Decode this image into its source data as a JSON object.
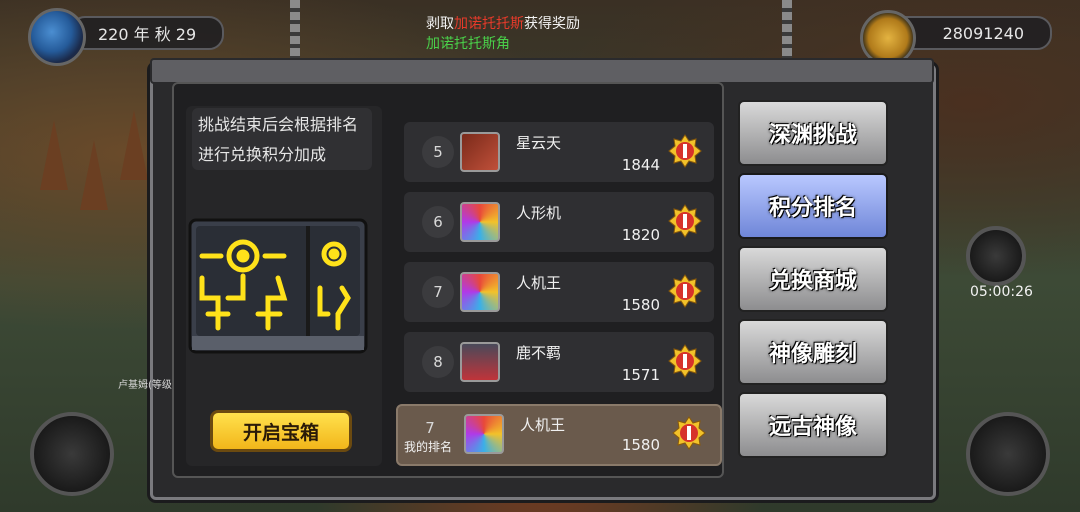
{
  "hud": {
    "date_text": "220 年 秋 29",
    "gold_amount": "28091240"
  },
  "notice": {
    "prefix": "剥取",
    "item_red": "加诺托托斯",
    "middle": "获得奖励",
    "reward_green": "加诺托托斯角"
  },
  "left_panel": {
    "tip_text": "挑战结束后会根据排名进行兑换积分加成",
    "open_chest_label": "开启宝箱"
  },
  "ranking": {
    "rows": [
      {
        "rank": "5",
        "name": "星云天",
        "score": "1844"
      },
      {
        "rank": "6",
        "name": "人形机",
        "score": "1820"
      },
      {
        "rank": "7",
        "name": "人机王",
        "score": "1580"
      },
      {
        "rank": "8",
        "name": "鹿不羁",
        "score": "1571"
      }
    ],
    "my_rank": {
      "label": "我的排名",
      "rank": "7",
      "name": "人机王",
      "score": "1580"
    }
  },
  "tabs": [
    {
      "label": "深渊挑战"
    },
    {
      "label": "积分排名"
    },
    {
      "label": "兑换商城"
    },
    {
      "label": "神像雕刻"
    },
    {
      "label": "远古神像"
    }
  ],
  "event_timer": "05:00:26",
  "map_label": "卢基姆(等级"
}
